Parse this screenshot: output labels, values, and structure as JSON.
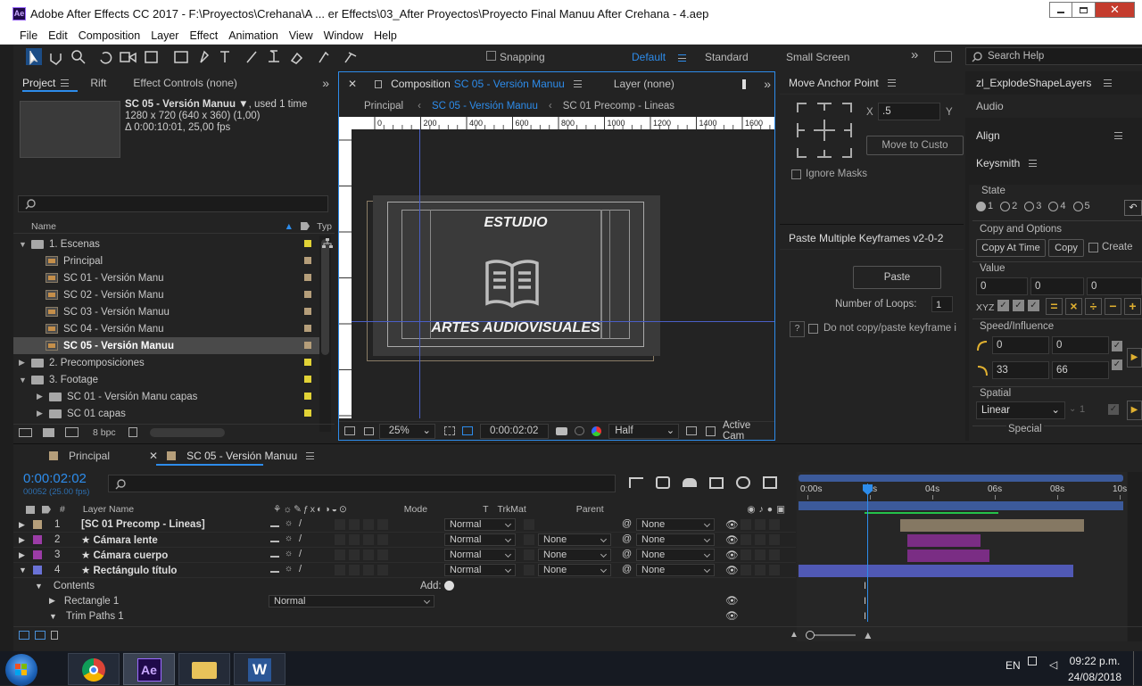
{
  "app": {
    "title": "Adobe After Effects CC 2017 - F:\\Proyectos\\Crehana\\A ... er Effects\\03_After Proyectos\\Proyecto Final Manuu After Crehana -  4.aep",
    "icon": "Ae"
  },
  "menu": [
    "File",
    "Edit",
    "Composition",
    "Layer",
    "Effect",
    "Animation",
    "View",
    "Window",
    "Help"
  ],
  "toolbar": {
    "snapping": "Snapping",
    "workspaces": [
      "Default",
      "Standard",
      "Small Screen"
    ],
    "search": "Search Help"
  },
  "project": {
    "tabs": [
      "Project",
      "Rift",
      "Effect Controls (none)"
    ],
    "item_name": "SC 05 - Versión Manuu",
    "used": ", used 1 time",
    "res": "1280 x 720  (640 x 360) (1,00)",
    "dur": "Δ 0:00:10:01, 25,00 fps",
    "col_name": "Name",
    "col_type": "Typ",
    "tree": [
      {
        "label": "1. Escenas",
        "kind": "folder",
        "indent": 0,
        "open": true,
        "color": "#e1d236"
      },
      {
        "label": "Principal",
        "kind": "comp",
        "indent": 1,
        "color": "#b59e7a"
      },
      {
        "label": "SC 01 - Versión Manu",
        "kind": "comp",
        "indent": 1,
        "color": "#b59e7a"
      },
      {
        "label": "SC 02 - Versión Manu",
        "kind": "comp",
        "indent": 1,
        "color": "#b59e7a"
      },
      {
        "label": "SC 03 - Versión Manuu",
        "kind": "comp",
        "indent": 1,
        "color": "#b59e7a"
      },
      {
        "label": "SC 04 - Versión Manu",
        "kind": "comp",
        "indent": 1,
        "color": "#b59e7a"
      },
      {
        "label": "SC 05 - Versión Manuu",
        "kind": "comp",
        "indent": 1,
        "color": "#b59e7a",
        "selected": true
      },
      {
        "label": "2. Precomposiciones",
        "kind": "folder",
        "indent": 0,
        "open": false,
        "color": "#e1d236"
      },
      {
        "label": "3. Footage",
        "kind": "folder",
        "indent": 0,
        "open": true,
        "color": "#e1d236"
      },
      {
        "label": "SC 01 - Versión Manu capas",
        "kind": "folder",
        "indent": 1,
        "open": false,
        "color": "#e1d236"
      },
      {
        "label": "SC 01 capas",
        "kind": "folder",
        "indent": 1,
        "open": false,
        "color": "#e1d236"
      }
    ],
    "bpc": "8 bpc"
  },
  "comp": {
    "tab_prefix": "Composition",
    "tab_name": "SC 05 - Versión Manuu",
    "layer_tab": "Layer (none)",
    "crumbs": [
      "Principal",
      "SC 05 - Versión Manuu",
      "SC 01 Precomp - Lineas"
    ],
    "ruler": [
      "0",
      "200",
      "400",
      "600",
      "800",
      "1000",
      "1200",
      "1400",
      "1600"
    ],
    "title_text": "ESTUDIO",
    "subtitle_text": "ARTES AUDIOVISUALES",
    "zoom": "25%",
    "time": "0:00:02:02",
    "quality": "Half",
    "camera": "Active Cam"
  },
  "anchor": {
    "title": "Move Anchor Point",
    "x_label": "X",
    "x_value": ".5",
    "y_label": "Y",
    "btn": "Move to Custo",
    "ignore": "Ignore Masks"
  },
  "paste": {
    "title": "Paste Multiple Keyframes v2-0-2",
    "btn": "Paste",
    "loops_label": "Number of Loops:",
    "loops": "1",
    "q": "?",
    "nocopy": "Do not copy/paste keyframe i"
  },
  "side": {
    "explode": "zl_ExplodeShapeLayers",
    "audio": "Audio",
    "align": "Align",
    "keysmith": "Keysmith",
    "state": "State",
    "states": [
      "1",
      "2",
      "3",
      "4",
      "5"
    ],
    "copy_opts": "Copy and Options",
    "copy_at": "Copy At Time",
    "copy": "Copy",
    "create": "Create",
    "value": "Value",
    "vals": [
      "0",
      "0",
      "0"
    ],
    "xyz": "XYZ",
    "ops": [
      "=",
      "×",
      "÷",
      "−",
      "+"
    ],
    "speed": "Speed/Influence",
    "s1": "0",
    "s2": "0",
    "s3": "33",
    "s4": "66",
    "spatial": "Spatial",
    "linear": "Linear",
    "spatial_num": "1",
    "special": "Special"
  },
  "timeline": {
    "tabs": [
      "Principal",
      "SC 05 - Versión Manuu"
    ],
    "time": "0:00:02:02",
    "frames": "00052 (25.00 fps)",
    "cols": {
      "num": "#",
      "name": "Layer Name",
      "mode": "Mode",
      "t": "T",
      "trk": "TrkMat",
      "parent": "Parent"
    },
    "ruler": [
      "0:00s",
      "02s",
      "04s",
      "06s",
      "08s",
      "10s"
    ],
    "layers": [
      {
        "num": "1",
        "name": "[SC 01 Precomp - Lineas]",
        "color": "#b59e7a",
        "mode": "Normal",
        "trk": "",
        "parent": "None"
      },
      {
        "num": "2",
        "name": "★ Cámara lente",
        "color": "#9b3ca6",
        "mode": "Normal",
        "trk": "None",
        "parent": "None"
      },
      {
        "num": "3",
        "name": "★ Cámara cuerpo",
        "color": "#9b3ca6",
        "mode": "Normal",
        "trk": "None",
        "parent": "None"
      },
      {
        "num": "4",
        "name": "★ Rectángulo título",
        "color": "#6a72d6",
        "mode": "Normal",
        "trk": "None",
        "parent": "None"
      }
    ],
    "contents": "Contents",
    "add": "Add:",
    "rect": "Rectangle 1",
    "rect_mode": "Normal",
    "trim": "Trim Paths 1"
  },
  "taskbar": {
    "lang": "EN",
    "time": "09:22 p.m.",
    "date": "24/08/2018"
  },
  "colors": {
    "accent": "#2d8ceb",
    "panel": "#232323",
    "dark": "#1b1b1b"
  }
}
